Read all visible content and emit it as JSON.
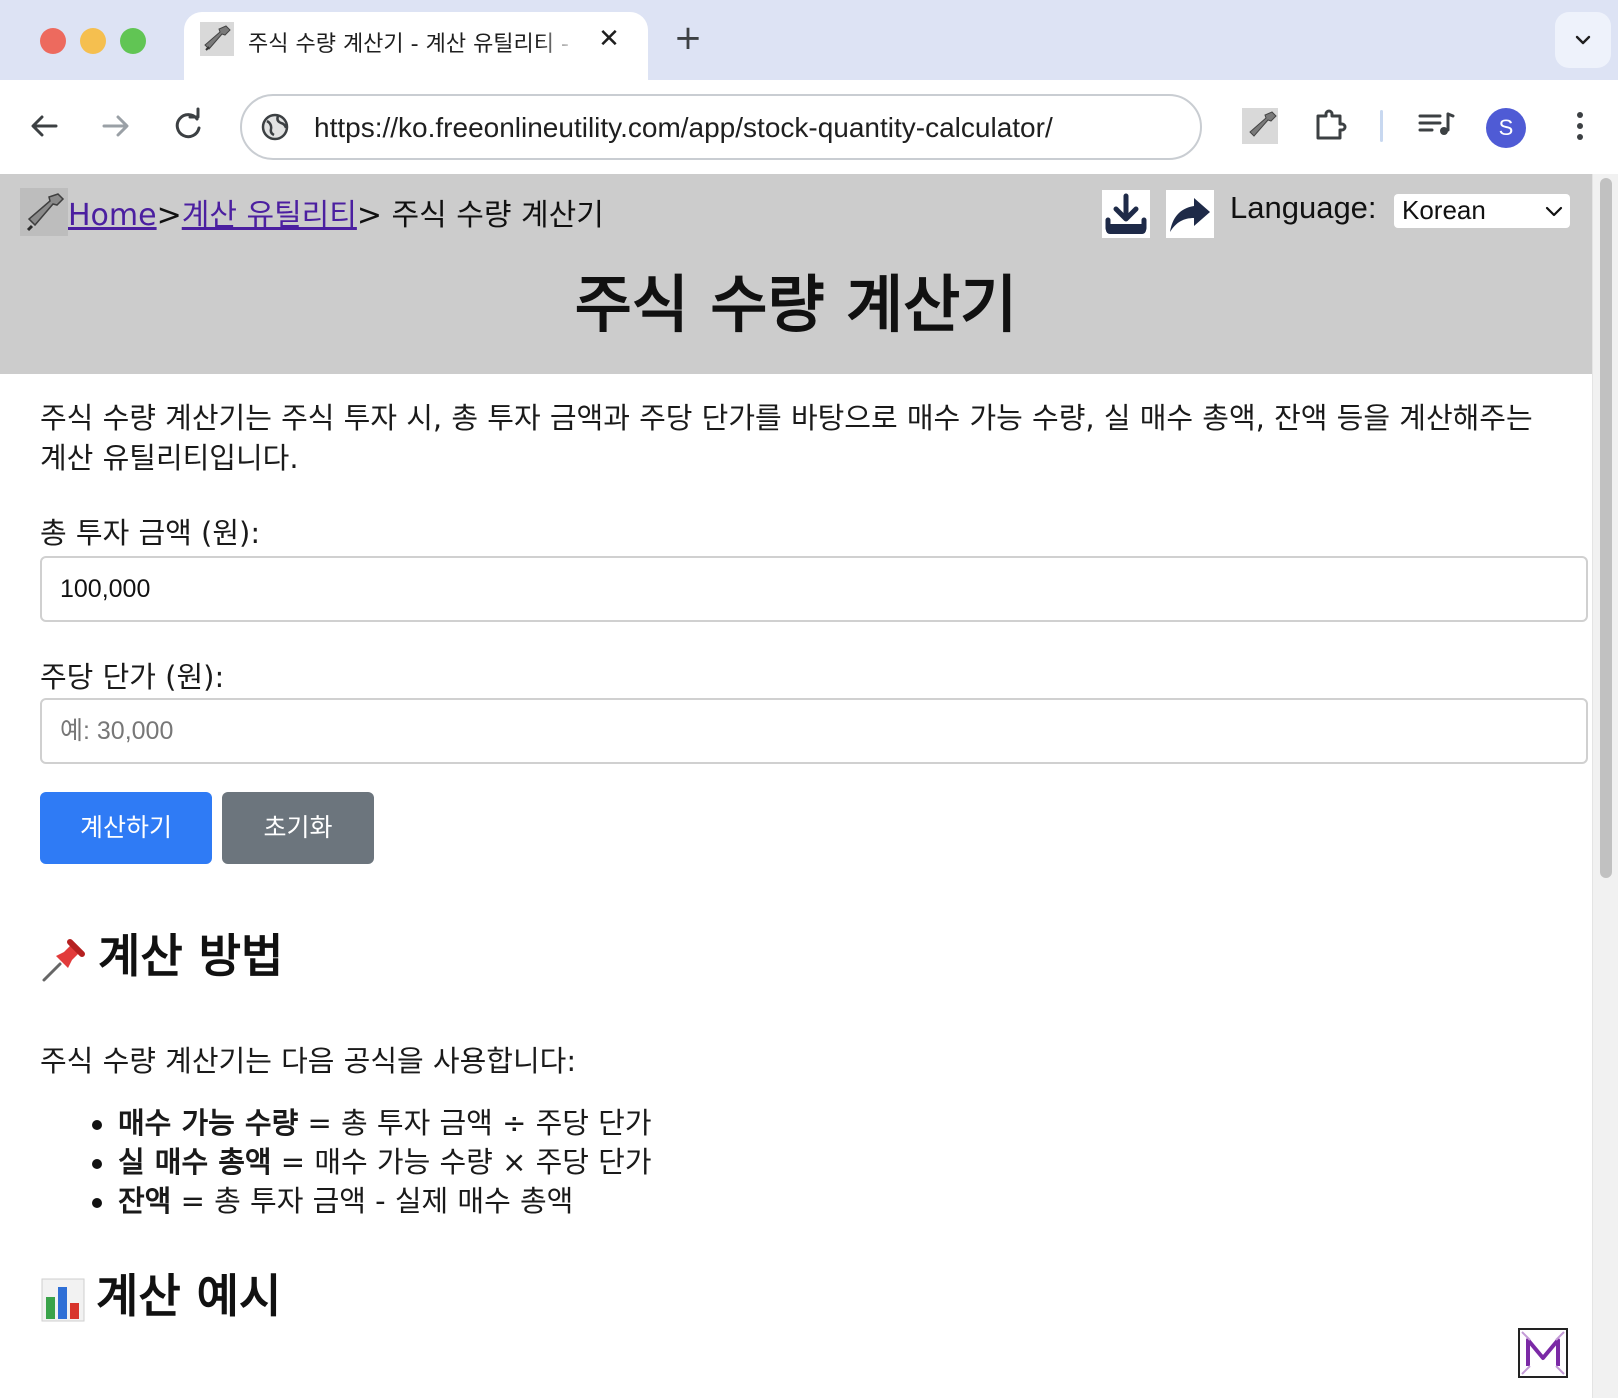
{
  "browser": {
    "tab_title": "주식 수량 계산기 - 계산 유틸리티 - Free Online Utility",
    "url": "https://ko.freeonlineutility.com/app/stock-quantity-calculator/",
    "new_tab_label": "+",
    "close_tab_label": "✕",
    "profile_initial": "S"
  },
  "header": {
    "breadcrumb": {
      "home": "Home",
      "separator": ">",
      "category": "계산 유틸리티",
      "current": "> 주식 수량 계산기"
    },
    "language_label": "Language:",
    "language_value": "Korean",
    "title": "주식 수량 계산기"
  },
  "main": {
    "intro": "주식 수량 계산기는 주식 투자 시, 총 투자 금액과 주당 단가를 바탕으로 매수 가능 수량, 실 매수 총액, 잔액 등을 계산해주는 계산 유틸리티입니다.",
    "fields": [
      {
        "label": "총 투자 금액 (원):",
        "value": "100,000",
        "placeholder": ""
      },
      {
        "label": "주당 단가 (원):",
        "value": "",
        "placeholder": "예: 30,000"
      }
    ],
    "buttons": {
      "calculate": "계산하기",
      "reset": "초기화"
    },
    "method_section": {
      "icon": "pushpin-icon",
      "title": "계산 방법",
      "description": "주식 수량 계산기는 다음 공식을 사용합니다:",
      "formulas": [
        {
          "term": "매수 가능 수량",
          "expr": " = 총 투자 금액 ÷ 주당 단가"
        },
        {
          "term": "실 매수 총액",
          "expr": " = 매수 가능 수량 × 주당 단가"
        },
        {
          "term": "잔액",
          "expr": " = 총 투자 금액 - 실제 매수 총액"
        }
      ]
    },
    "example_section": {
      "icon": "bar-chart-icon",
      "title": "계산 예시"
    }
  },
  "colors": {
    "primary_button": "#2f7bf5",
    "secondary_button": "#6c757d",
    "header_bg": "#cccccc",
    "link": "#4b1fa0"
  }
}
